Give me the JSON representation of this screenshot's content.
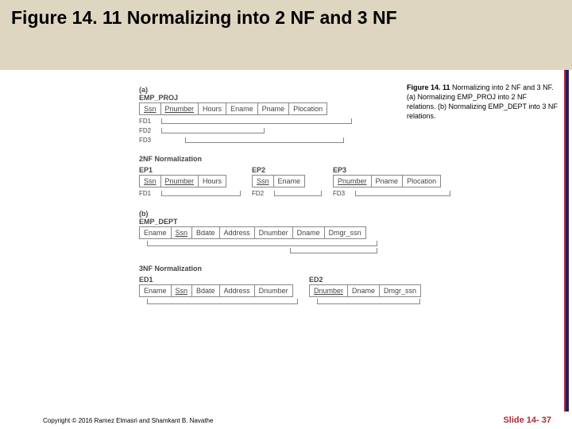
{
  "title": "Figure 14. 11 Normalizing into 2 NF and 3 NF",
  "caption": {
    "fig": "Figure 14. 11",
    "text": "Normalizing into 2 NF and 3 NF. (a) Normalizing EMP_PROJ into 2 NF relations. (b) Normalizing EMP_DEPT into 3 NF relations."
  },
  "copyright": "Copyright © 2016 Ramez Elmasri and Shamkant B. Navathe",
  "slide": "Slide 14- 37",
  "diag": {
    "a": "(a)",
    "b": "(b)",
    "emp_proj": "EMP_PROJ",
    "emp_dept": "EMP_DEPT",
    "ssn": "Ssn",
    "pnumber": "Pnumber",
    "hours": "Hours",
    "ename": "Ename",
    "pname": "Pname",
    "plocation": "Plocation",
    "bdate": "Bdate",
    "address": "Address",
    "dnumber": "Dnumber",
    "dname": "Dname",
    "dmgr": "Dmgr_ssn",
    "fd1": "FD1",
    "fd2": "FD2",
    "fd3": "FD3",
    "norm2": "2NF Normalization",
    "norm3": "3NF Normalization",
    "ep1": "EP1",
    "ep2": "EP2",
    "ep3": "EP3",
    "ed1": "ED1",
    "ed2": "ED2"
  }
}
